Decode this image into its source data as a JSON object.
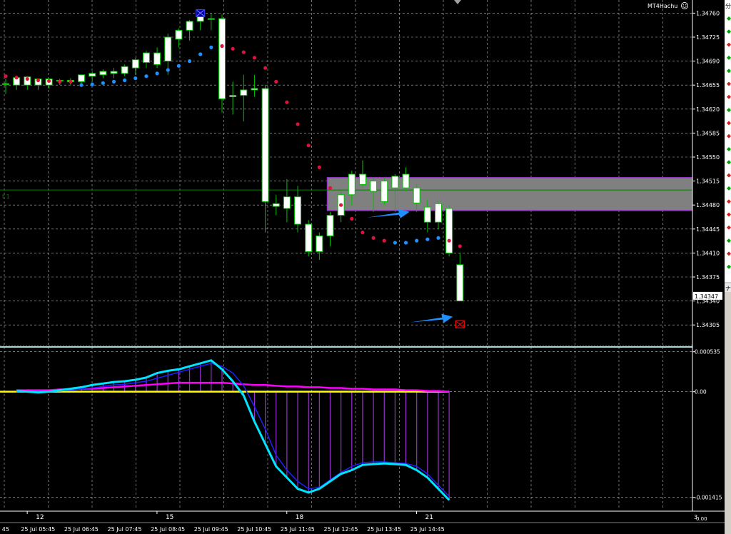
{
  "window": {
    "label": "MT4Hachu",
    "smiley_icon": "smiley-face-icon",
    "scroll_marker_icon": "scroll-marker-icon"
  },
  "colors": {
    "background": "#000000",
    "grid": "#b9b9b9",
    "candle_up": "#00c000",
    "candle_body": "#ffffff",
    "sar_down": "#dc143c",
    "sar_up": "#1e90ff",
    "zone_fill": "#808080",
    "zone_border": "#9932cc",
    "hline": "#008000",
    "price_tag": "#ffffff",
    "separator": "#a9d5d5",
    "macd_fast": "#00e5ff",
    "macd_slow": "#2020ff",
    "macd_hist": "#9932cc",
    "macd_signal": "#ff00ff",
    "macd_zero": "#ffff00",
    "arrow": "#1e90ff",
    "marker": "#ff0000"
  },
  "chart_data": [
    {
      "type": "candlestick",
      "title": "",
      "y_ticks": [
        "1.34760",
        "1.34725",
        "1.34690",
        "1.34655",
        "1.34620",
        "1.34585",
        "1.34550",
        "1.34515",
        "1.34480",
        "1.34445",
        "1.34410",
        "1.34375",
        "1.34340",
        "1.34305"
      ],
      "ylim": [
        1.34275,
        1.34775
      ],
      "current_price": "1.34347",
      "hline_price": 1.34502,
      "hline_label": "t 1",
      "zone": {
        "from_bar": 30,
        "to_bar": "end",
        "high": 1.3452,
        "low": 1.34472
      },
      "candles": [
        {
          "o": 1.34657,
          "h": 1.34664,
          "l": 1.34642,
          "c": 1.34657
        },
        {
          "o": 1.34655,
          "h": 1.34668,
          "l": 1.34648,
          "c": 1.34666
        },
        {
          "o": 1.34667,
          "h": 1.34668,
          "l": 1.34648,
          "c": 1.34655
        },
        {
          "o": 1.34655,
          "h": 1.34664,
          "l": 1.34648,
          "c": 1.34664
        },
        {
          "o": 1.34655,
          "h": 1.34664,
          "l": 1.3465,
          "c": 1.34664
        },
        {
          "o": 1.34662,
          "h": 1.34664,
          "l": 1.34655,
          "c": 1.34661
        },
        {
          "o": 1.3466,
          "h": 1.34665,
          "l": 1.34655,
          "c": 1.34662
        },
        {
          "o": 1.3466,
          "h": 1.3467,
          "l": 1.34655,
          "c": 1.3467
        },
        {
          "o": 1.34668,
          "h": 1.34675,
          "l": 1.3466,
          "c": 1.34672
        },
        {
          "o": 1.3467,
          "h": 1.34678,
          "l": 1.34665,
          "c": 1.34675
        },
        {
          "o": 1.34672,
          "h": 1.3468,
          "l": 1.34665,
          "c": 1.34675
        },
        {
          "o": 1.34672,
          "h": 1.34685,
          "l": 1.34668,
          "c": 1.34682
        },
        {
          "o": 1.3468,
          "h": 1.34695,
          "l": 1.3467,
          "c": 1.34692
        },
        {
          "o": 1.34688,
          "h": 1.34705,
          "l": 1.3468,
          "c": 1.34702
        },
        {
          "o": 1.34702,
          "h": 1.3471,
          "l": 1.3468,
          "c": 1.34685
        },
        {
          "o": 1.3469,
          "h": 1.3473,
          "l": 1.3467,
          "c": 1.34725
        },
        {
          "o": 1.34722,
          "h": 1.34738,
          "l": 1.3471,
          "c": 1.34735
        },
        {
          "o": 1.34735,
          "h": 1.3475,
          "l": 1.3472,
          "c": 1.34748
        },
        {
          "o": 1.34748,
          "h": 1.34765,
          "l": 1.34735,
          "c": 1.34755
        },
        {
          "o": 1.34752,
          "h": 1.3476,
          "l": 1.34735,
          "c": 1.34752
        },
        {
          "o": 1.34752,
          "h": 1.34758,
          "l": 1.34615,
          "c": 1.34635
        },
        {
          "o": 1.34638,
          "h": 1.3466,
          "l": 1.34612,
          "c": 1.3464
        },
        {
          "o": 1.3464,
          "h": 1.3467,
          "l": 1.34602,
          "c": 1.34648
        },
        {
          "o": 1.34648,
          "h": 1.3467,
          "l": 1.34638,
          "c": 1.3465
        },
        {
          "o": 1.3465,
          "h": 1.34655,
          "l": 1.3444,
          "c": 1.34485
        },
        {
          "o": 1.34482,
          "h": 1.34495,
          "l": 1.34465,
          "c": 1.34478
        },
        {
          "o": 1.34475,
          "h": 1.34518,
          "l": 1.34455,
          "c": 1.34492
        },
        {
          "o": 1.34492,
          "h": 1.34508,
          "l": 1.3444,
          "c": 1.34452
        },
        {
          "o": 1.34452,
          "h": 1.34458,
          "l": 1.34405,
          "c": 1.34412
        },
        {
          "o": 1.34412,
          "h": 1.3444,
          "l": 1.344,
          "c": 1.34435
        },
        {
          "o": 1.34435,
          "h": 1.3447,
          "l": 1.3442,
          "c": 1.34465
        },
        {
          "o": 1.34465,
          "h": 1.345,
          "l": 1.34455,
          "c": 1.34495
        },
        {
          "o": 1.34495,
          "h": 1.3453,
          "l": 1.3448,
          "c": 1.34525
        },
        {
          "o": 1.34525,
          "h": 1.34545,
          "l": 1.34505,
          "c": 1.3451
        },
        {
          "o": 1.345,
          "h": 1.3452,
          "l": 1.3447,
          "c": 1.34515
        },
        {
          "o": 1.34515,
          "h": 1.3452,
          "l": 1.3448,
          "c": 1.34485
        },
        {
          "o": 1.34505,
          "h": 1.34525,
          "l": 1.3447,
          "c": 1.34522
        },
        {
          "o": 1.34525,
          "h": 1.34535,
          "l": 1.345,
          "c": 1.34505
        },
        {
          "o": 1.34505,
          "h": 1.3451,
          "l": 1.3447,
          "c": 1.34483
        },
        {
          "o": 1.34477,
          "h": 1.34488,
          "l": 1.3444,
          "c": 1.34455
        },
        {
          "o": 1.34455,
          "h": 1.34485,
          "l": 1.34445,
          "c": 1.34482
        },
        {
          "o": 1.34475,
          "h": 1.3448,
          "l": 1.34405,
          "c": 1.3441
        },
        {
          "o": 1.34393,
          "h": 1.3441,
          "l": 1.3434,
          "c": 1.3434
        }
      ],
      "sar": [
        {
          "v": 1.34668,
          "dir": "down"
        },
        {
          "v": 1.34666,
          "dir": "down"
        },
        {
          "v": 1.34664,
          "dir": "down"
        },
        {
          "v": 1.34662,
          "dir": "down"
        },
        {
          "v": 1.34661,
          "dir": "down"
        },
        {
          "v": 1.3466,
          "dir": "down"
        },
        {
          "v": 1.3466,
          "dir": "down"
        },
        {
          "v": 1.34655,
          "dir": "up"
        },
        {
          "v": 1.34656,
          "dir": "up"
        },
        {
          "v": 1.34658,
          "dir": "up"
        },
        {
          "v": 1.3466,
          "dir": "up"
        },
        {
          "v": 1.34662,
          "dir": "up"
        },
        {
          "v": 1.34665,
          "dir": "up"
        },
        {
          "v": 1.34668,
          "dir": "up"
        },
        {
          "v": 1.34672,
          "dir": "up"
        },
        {
          "v": 1.34677,
          "dir": "up"
        },
        {
          "v": 1.34683,
          "dir": "up"
        },
        {
          "v": 1.3469,
          "dir": "up"
        },
        {
          "v": 1.347,
          "dir": "up"
        },
        {
          "v": 1.3471,
          "dir": "up"
        },
        {
          "v": 1.34712,
          "dir": "down"
        },
        {
          "v": 1.34708,
          "dir": "down"
        },
        {
          "v": 1.34703,
          "dir": "down"
        },
        {
          "v": 1.34695,
          "dir": "down"
        },
        {
          "v": 1.3468,
          "dir": "down"
        },
        {
          "v": 1.3466,
          "dir": "down"
        },
        {
          "v": 1.3463,
          "dir": "down"
        },
        {
          "v": 1.34598,
          "dir": "down"
        },
        {
          "v": 1.34567,
          "dir": "down"
        },
        {
          "v": 1.34535,
          "dir": "down"
        },
        {
          "v": 1.34505,
          "dir": "down"
        },
        {
          "v": 1.3448,
          "dir": "down"
        },
        {
          "v": 1.3446,
          "dir": "down"
        },
        {
          "v": 1.3444,
          "dir": "down"
        },
        {
          "v": 1.34432,
          "dir": "down"
        },
        {
          "v": 1.34428,
          "dir": "down"
        },
        {
          "v": 1.34425,
          "dir": "up"
        },
        {
          "v": 1.34425,
          "dir": "up"
        },
        {
          "v": 1.34428,
          "dir": "up"
        },
        {
          "v": 1.3443,
          "dir": "up"
        },
        {
          "v": 1.34432,
          "dir": "up"
        },
        {
          "v": 1.34428,
          "dir": "down"
        },
        {
          "v": 1.3442,
          "dir": "down"
        }
      ],
      "annotations": [
        {
          "kind": "arrow",
          "bar": 38,
          "price": 1.3447,
          "label": "arrow-1"
        },
        {
          "kind": "arrow",
          "bar": 42,
          "price": 1.34317,
          "label": "arrow-2"
        },
        {
          "kind": "sell-stop-marker",
          "bar": 42,
          "price": 1.34306
        },
        {
          "kind": "buy-top-marker",
          "bar": 18,
          "price": 1.3476
        }
      ]
    },
    {
      "type": "macd",
      "y_ticks": [
        "0.000535",
        "0.00",
        "-0.001415"
      ],
      "ylim": [
        -0.00158,
        0.00058
      ],
      "fast": [
        1e-05,
        0.0,
        -1e-05,
        0.0,
        2e-05,
        4e-05,
        6e-05,
        9e-05,
        0.00011,
        0.00013,
        0.00014,
        0.00016,
        0.00019,
        0.00025,
        0.00028,
        0.0003,
        0.00034,
        0.00038,
        0.00042,
        0.0003,
        0.00014,
        -5e-05,
        -0.0004,
        -0.0007,
        -0.001,
        -0.00115,
        -0.0013,
        -0.00135,
        -0.0013,
        -0.0012,
        -0.0011,
        -0.00105,
        -0.00098,
        -0.00097,
        -0.00096,
        -0.00097,
        -0.00098,
        -0.00105,
        -0.00115,
        -0.0013,
        -0.00145
      ],
      "slow": [
        0.0,
        0.0,
        0.0,
        0.0,
        1e-05,
        2e-05,
        4e-05,
        5e-05,
        7e-05,
        9e-05,
        0.0001,
        0.00012,
        0.00014,
        0.00018,
        0.00022,
        0.00026,
        0.0003,
        0.00034,
        0.00038,
        0.00034,
        0.00025,
        8e-05,
        -0.0002,
        -0.0005,
        -0.00085,
        -0.00105,
        -0.0012,
        -0.0013,
        -0.00128,
        -0.00118,
        -0.00108,
        -0.001,
        -0.00095,
        -0.00094,
        -0.00094,
        -0.00095,
        -0.00096,
        -0.001,
        -0.0011,
        -0.00125,
        -0.0014
      ],
      "signal": [
        2e-05,
        2e-05,
        2e-05,
        2e-05,
        3e-05,
        3e-05,
        4e-05,
        4e-05,
        5e-05,
        6e-05,
        7e-05,
        8e-05,
        9e-05,
        0.0001,
        0.00011,
        0.00012,
        0.00012,
        0.00012,
        0.00012,
        0.00012,
        0.00011,
        0.0001,
        9e-05,
        9e-05,
        8e-05,
        7e-05,
        7e-05,
        6e-05,
        6e-05,
        5e-05,
        5e-05,
        4e-05,
        4e-05,
        3e-05,
        3e-05,
        3e-05,
        2e-05,
        2e-05,
        1e-05,
        1e-05,
        0.0
      ],
      "zero_line": 0.0
    }
  ],
  "x_axis": {
    "top_row": [
      {
        "text": "12",
        "bar": 1
      },
      {
        "text": "15",
        "bar": 13
      },
      {
        "text": "18",
        "bar": 25
      },
      {
        "text": "21",
        "bar": 37
      }
    ],
    "bottom_row": [
      {
        "text": "45",
        "bar": -1
      },
      {
        "text": "25 Jul 05:45",
        "bar": 2
      },
      {
        "text": "25 Jul 06:45",
        "bar": 6
      },
      {
        "text": "25 Jul 07:45",
        "bar": 10
      },
      {
        "text": "25 Jul 08:45",
        "bar": 14
      },
      {
        "text": "25 Jul 09:45",
        "bar": 18
      },
      {
        "text": "25 Jul 10:45",
        "bar": 22
      },
      {
        "text": "25 Jul 11:45",
        "bar": 26
      },
      {
        "text": "25 Jul 12:45",
        "bar": 30
      },
      {
        "text": "25 Jul 13:45",
        "bar": 34
      },
      {
        "text": "25 Jul 14:45",
        "bar": 38
      }
    ],
    "right_corner_top": "3",
    "right_corner_bottom": "0.00"
  },
  "right_panel": {
    "header_glyph": "分",
    "header_glyph_2": "ナ",
    "row_icons": [
      "up",
      "up",
      "down",
      "up",
      "up",
      "down",
      "down",
      "up",
      "down",
      "down",
      "up",
      "up",
      "down",
      "up",
      "down",
      "down",
      "down",
      "up",
      "down",
      "up"
    ]
  }
}
